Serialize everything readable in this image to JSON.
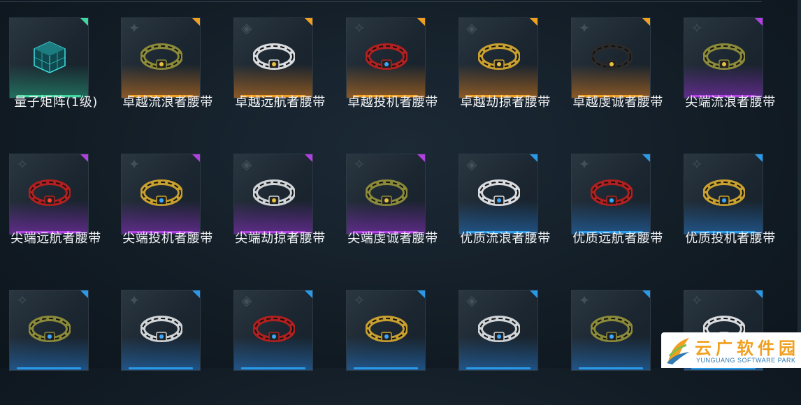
{
  "colors": {
    "green": "#3fd6a0",
    "orange": "#f0a020",
    "purple": "#b040e0",
    "blue": "#2a9ae8"
  },
  "items": [
    {
      "name": "量子矩阵(1级)",
      "rarity": "green",
      "icon": "quantum-cube-icon"
    },
    {
      "name": "卓越流浪者腰带",
      "rarity": "orange",
      "icon": "belt-icon"
    },
    {
      "name": "卓越远航者腰带",
      "rarity": "orange",
      "icon": "belt-icon"
    },
    {
      "name": "卓越投机者腰带",
      "rarity": "orange",
      "icon": "belt-icon"
    },
    {
      "name": "卓越劫掠者腰带",
      "rarity": "orange",
      "icon": "belt-icon"
    },
    {
      "name": "卓越虔诚者腰带",
      "rarity": "orange",
      "icon": "belt-icon"
    },
    {
      "name": "尖端流浪者腰带",
      "rarity": "purple",
      "icon": "belt-icon"
    },
    {
      "name": "尖端远航者腰带",
      "rarity": "purple",
      "icon": "belt-icon"
    },
    {
      "name": "尖端投机者腰带",
      "rarity": "purple",
      "icon": "belt-icon"
    },
    {
      "name": "尖端劫掠者腰带",
      "rarity": "purple",
      "icon": "belt-icon"
    },
    {
      "name": "尖端虔诚者腰带",
      "rarity": "purple",
      "icon": "belt-icon"
    },
    {
      "name": "优质流浪者腰带",
      "rarity": "blue",
      "icon": "belt-icon"
    },
    {
      "name": "优质远航者腰带",
      "rarity": "blue",
      "icon": "belt-icon"
    },
    {
      "name": "优质投机者腰带",
      "rarity": "blue",
      "icon": "belt-icon"
    },
    {
      "name": "",
      "rarity": "blue",
      "icon": "belt-icon"
    },
    {
      "name": "",
      "rarity": "blue",
      "icon": "belt-icon"
    },
    {
      "name": "",
      "rarity": "blue",
      "icon": "belt-icon"
    },
    {
      "name": "",
      "rarity": "blue",
      "icon": "belt-icon"
    },
    {
      "name": "",
      "rarity": "blue",
      "icon": "belt-icon"
    },
    {
      "name": "",
      "rarity": "blue",
      "icon": "belt-icon"
    },
    {
      "name": "",
      "rarity": "blue",
      "icon": "belt-icon"
    }
  ],
  "watermark": {
    "title": "云广软件园",
    "subtitle": "YUNGUANG SOFTWARE PARK"
  }
}
